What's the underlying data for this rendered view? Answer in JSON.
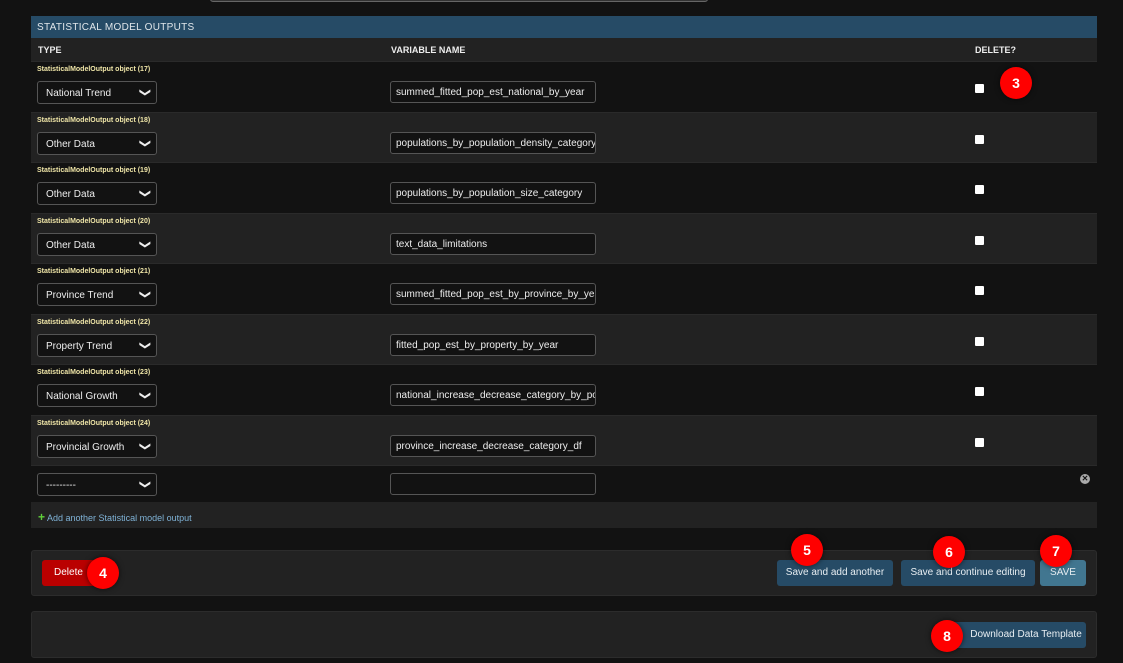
{
  "module": {
    "caption": "STATISTICAL MODEL OUTPUTS",
    "columns": [
      "TYPE",
      "VARIABLE NAME",
      "DELETE?"
    ]
  },
  "rows": [
    {
      "label": "StatisticalModelOutput object (17)",
      "type": "National Trend",
      "variable": "summed_fitted_pop_est_national_by_year",
      "delete": false
    },
    {
      "label": "StatisticalModelOutput object (18)",
      "type": "Other Data",
      "variable": "populations_by_population_density_category",
      "delete": false
    },
    {
      "label": "StatisticalModelOutput object (19)",
      "type": "Other Data",
      "variable": "populations_by_population_size_category",
      "delete": false
    },
    {
      "label": "StatisticalModelOutput object (20)",
      "type": "Other Data",
      "variable": "text_data_limitations",
      "delete": false
    },
    {
      "label": "StatisticalModelOutput object (21)",
      "type": "Province Trend",
      "variable": "summed_fitted_pop_est_by_province_by_year",
      "delete": false
    },
    {
      "label": "StatisticalModelOutput object (22)",
      "type": "Property Trend",
      "variable": "fitted_pop_est_by_property_by_year",
      "delete": false
    },
    {
      "label": "StatisticalModelOutput object (23)",
      "type": "National Growth",
      "variable": "national_increase_decrease_category_by_population",
      "delete": false
    },
    {
      "label": "StatisticalModelOutput object (24)",
      "type": "Provincial Growth",
      "variable": "province_increase_decrease_category_df",
      "delete": false
    }
  ],
  "empty_row": {
    "type": "---------",
    "variable": ""
  },
  "add_link": "Add another Statistical model output",
  "buttons": {
    "delete": "Delete",
    "save_add": "Save and add another",
    "save_continue": "Save and continue editing",
    "save": "SAVE",
    "download": "Download Data Template"
  },
  "markers": [
    "3",
    "4",
    "5",
    "6",
    "7",
    "8"
  ],
  "colors": {
    "caption": "#264b66",
    "delete": "#ba0000",
    "marker": "#ff0000",
    "button": "#264b66"
  }
}
